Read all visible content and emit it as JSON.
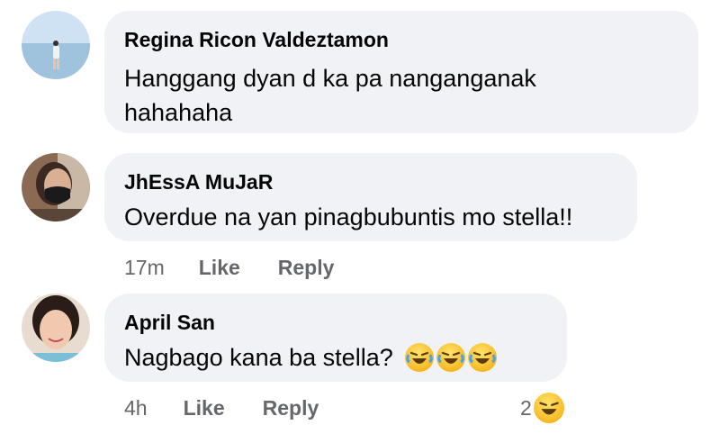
{
  "comments": [
    {
      "author": "Regina Ricon Valdeztamon",
      "text_lines": [
        "Hanggang dyan d ka pa nanganganak",
        "hahahaha"
      ]
    },
    {
      "author": "JhEssA MuJaR",
      "text": "Overdue na yan pinagbubuntis mo stella!!",
      "time": "17m",
      "like_label": "Like",
      "reply_label": "Reply"
    },
    {
      "author": "April San",
      "text": "Nagbago kana ba stella?",
      "emojis": [
        "laughing-face-icon",
        "laughing-face-icon",
        "laughing-face-icon"
      ],
      "time": "4h",
      "like_label": "Like",
      "reply_label": "Reply",
      "reaction_count": "2",
      "reaction_icon": "laughing-face-icon"
    }
  ]
}
